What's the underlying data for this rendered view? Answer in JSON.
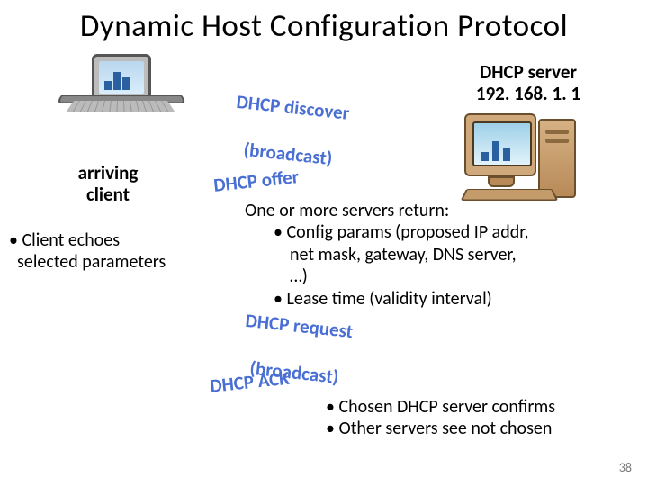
{
  "title": "Dynamic Host Configuration Protocol",
  "client_label_l1": "arriving",
  "client_label_l2": "client",
  "server_label_l1": "DHCP server",
  "server_label_l2": "192. 168. 1. 1",
  "messages": {
    "discover_l1": "DHCP discover",
    "discover_l2": "(broadcast)",
    "offer": "DHCP offer",
    "request_l1": "DHCP request",
    "request_l2": "(broadcast)",
    "ack": "DHCP ACK"
  },
  "echoes_l1": "• Client echoes",
  "echoes_l2": "selected parameters",
  "offer_return": "One or more servers return:",
  "offer_b1a": "• Config params (proposed IP addr,",
  "offer_b1b": "net mask, gateway, DNS server,",
  "offer_b1c": "…)",
  "offer_b2": "• Lease time (validity interval)",
  "ack_b1": "• Chosen DHCP server confirms",
  "ack_b2": "• Other servers see not chosen",
  "page_number": "38"
}
